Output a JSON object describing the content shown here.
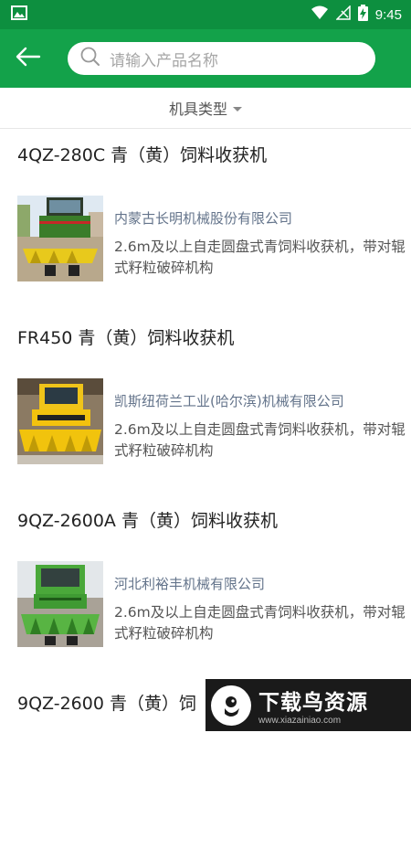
{
  "statusbar": {
    "time": "9:45",
    "icons": [
      "image-icon",
      "wifi-icon",
      "no-signal-icon",
      "battery-charging-icon"
    ]
  },
  "appbar": {
    "back_icon": "back-arrow-icon",
    "search_icon": "search-icon",
    "search_placeholder": "请输入产品名称"
  },
  "filter": {
    "label": "机具类型",
    "icon": "caret-down-icon"
  },
  "products": [
    {
      "title": "4QZ-280C 青（黄）饲料收获机",
      "company": "内蒙古长明机械股份有限公司",
      "description": "2.6m及以上自走圆盘式青饲料收获机，带对辊式籽粒破碎机构",
      "image": "harvester-photo"
    },
    {
      "title": "FR450 青（黄）饲料收获机",
      "company": "凯斯纽荷兰工业(哈尔滨)机械有限公司",
      "description": "2.6m及以上自走圆盘式青饲料收获机，带对辊式籽粒破碎机构",
      "image": "harvester-photo"
    },
    {
      "title": "9QZ-2600A 青（黄）饲料收获机",
      "company": "河北利裕丰机械有限公司",
      "description": "2.6m及以上自走圆盘式青饲料收获机，带对辊式籽粒破碎机构",
      "image": "harvester-photo"
    },
    {
      "title": "9QZ-2600 青（黄）饲",
      "company": "",
      "description": "",
      "image": ""
    }
  ],
  "watermark": {
    "main_text": "下载鸟资源",
    "sub_text": "www.xiazainiao.com"
  },
  "colors": {
    "appbar": "#13a24a",
    "statusbar": "#0d8f3f",
    "company_text": "#64748b"
  }
}
